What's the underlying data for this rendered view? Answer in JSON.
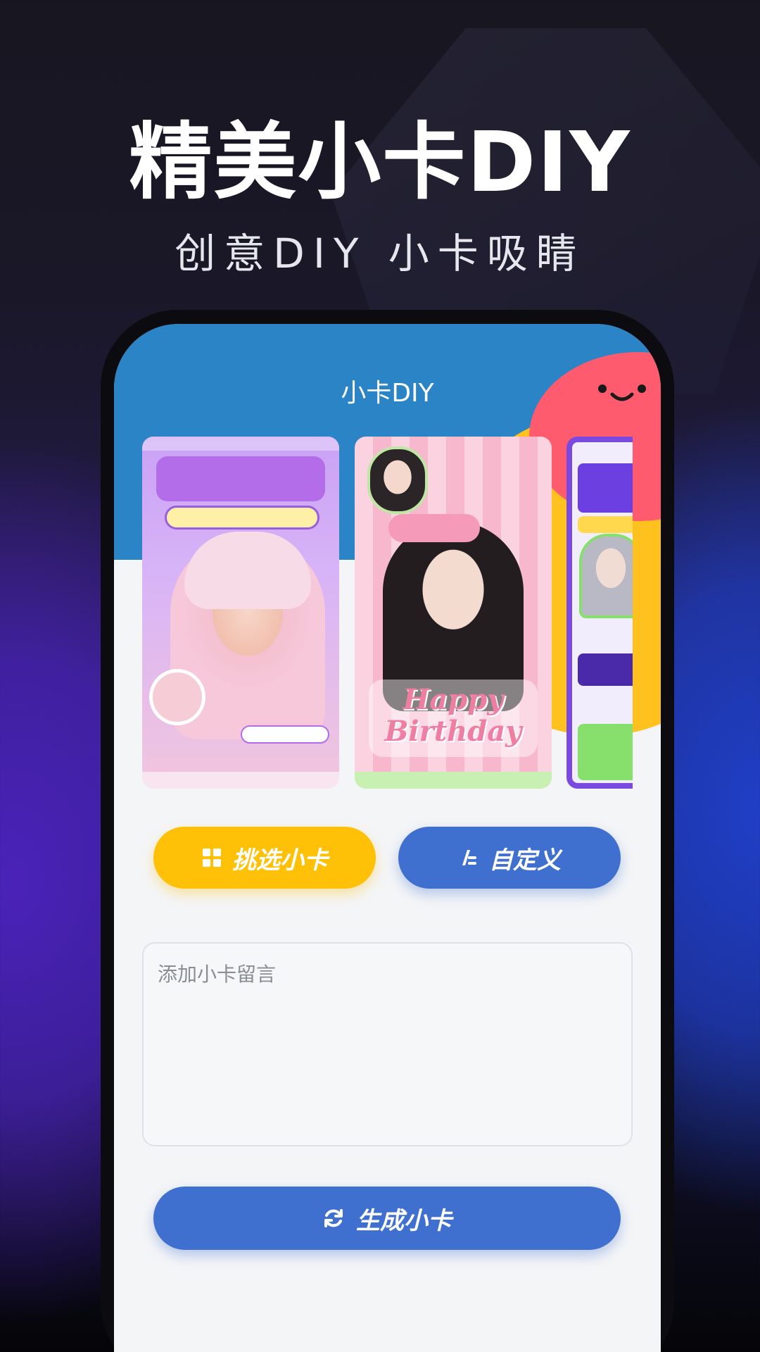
{
  "headline": "精美小卡DIY",
  "subline": "创意DIY 小卡吸睛",
  "screen": {
    "title": "小卡DIY"
  },
  "cards": [
    {
      "name": "card-wotuide"
    },
    {
      "name": "card-happy-birthday",
      "text_lines": [
        "Happy",
        "Birthday"
      ]
    },
    {
      "name": "card-partial"
    }
  ],
  "buttons": {
    "pick_label": "挑选小卡",
    "custom_label": "自定义",
    "generate_label": "生成小卡"
  },
  "message": {
    "placeholder": "添加小卡留言",
    "value": ""
  },
  "colors": {
    "hero_blue": "#2a84c6",
    "accent_yellow": "#ffc107",
    "accent_blue": "#3f6fcf",
    "blob_red": "#ff5b6e"
  },
  "icons": {
    "pick": "grid-icon",
    "custom": "edit-icon",
    "generate": "refresh-icon"
  }
}
